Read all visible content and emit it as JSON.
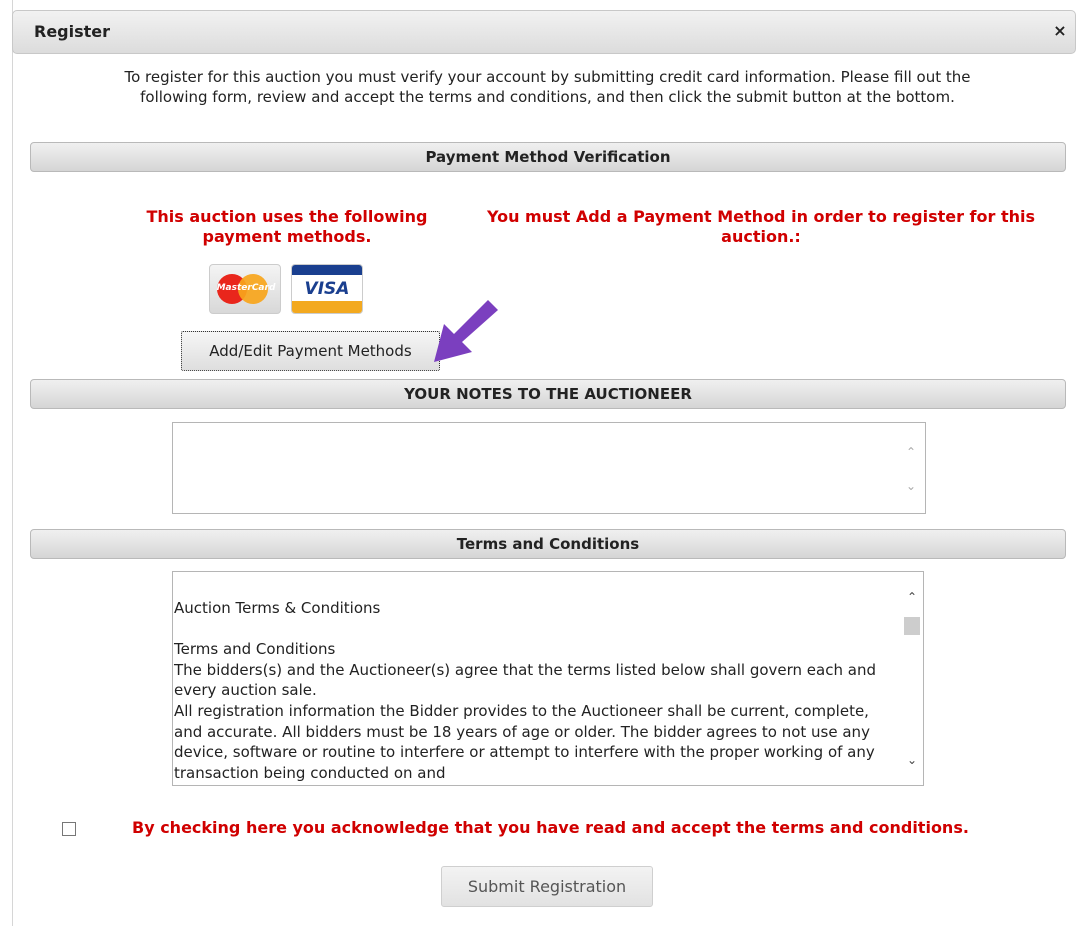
{
  "dialog": {
    "title": "Register",
    "close_glyph": "×"
  },
  "intro_text": "To register for this auction you must verify your account by submitting credit card information. Please fill out the following form, review and accept the terms and conditions, and then click the submit button at the bottom.",
  "payment": {
    "header": "Payment Method Verification",
    "uses_methods_note": "This auction uses the following payment methods.",
    "must_add_note": "You must Add a Payment Method in order to register for this auction.:",
    "cards": [
      {
        "name": "MasterCard",
        "icon": "mastercard-logo"
      },
      {
        "name": "VISA",
        "icon": "visa-logo"
      }
    ],
    "add_edit_button": "Add/Edit Payment Methods",
    "arrow_color": "#7b3fbf"
  },
  "notes": {
    "header": "YOUR NOTES TO THE AUCTIONEER",
    "value": ""
  },
  "terms": {
    "header": "Terms and Conditions",
    "lines": [
      "Auction Terms & Conditions",
      "",
      "Terms and Conditions",
      "The bidders(s) and the Auctioneer(s) agree that the terms listed below shall govern each and every auction sale.",
      "All registration information the Bidder provides to the Auctioneer shall be current, complete, and accurate. All bidders must be 18 years of age or older. The bidder agrees to not use any device, software or routine to interfere or attempt to interfere with the proper working of any transaction being conducted on and"
    ]
  },
  "acknowledge": {
    "label": "By checking here you acknowledge that you have read and accept the terms and conditions.",
    "checked": false
  },
  "submit_button": "Submit Registration",
  "colors": {
    "accent_red": "#d00000",
    "arrow_purple": "#7b3fbf"
  }
}
